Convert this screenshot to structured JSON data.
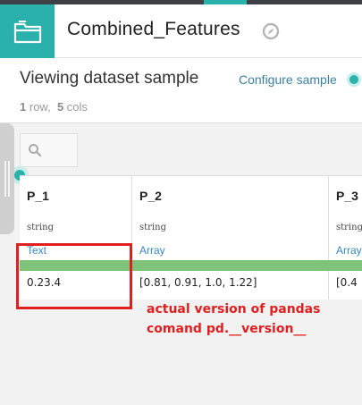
{
  "app": {
    "title": "Combined_Features",
    "accent_color": "#2ab1ac",
    "tile_icon": "folder-icon",
    "title_icon": "compass-icon"
  },
  "dataset": {
    "heading": "Viewing dataset sample",
    "configure_label": "Configure sample",
    "row_count": "1",
    "row_label": "row,",
    "col_count": "5",
    "col_label": "cols"
  },
  "search": {
    "icon": "search-icon"
  },
  "columns": [
    {
      "name": "P_1",
      "type": "string",
      "meaning": "Text",
      "value": "0.23.4"
    },
    {
      "name": "P_2",
      "type": "string",
      "meaning": "Array",
      "value": "[0.81, 0.91, 1.0, 1.22]"
    },
    {
      "name": "P_3",
      "type": "string",
      "meaning": "Array",
      "value": "[0.4"
    }
  ],
  "annotation": {
    "line1": "actual version of pandas",
    "line2": "comand pd.__version__",
    "color": "#e02020"
  },
  "validity_color": "#7fc37a"
}
